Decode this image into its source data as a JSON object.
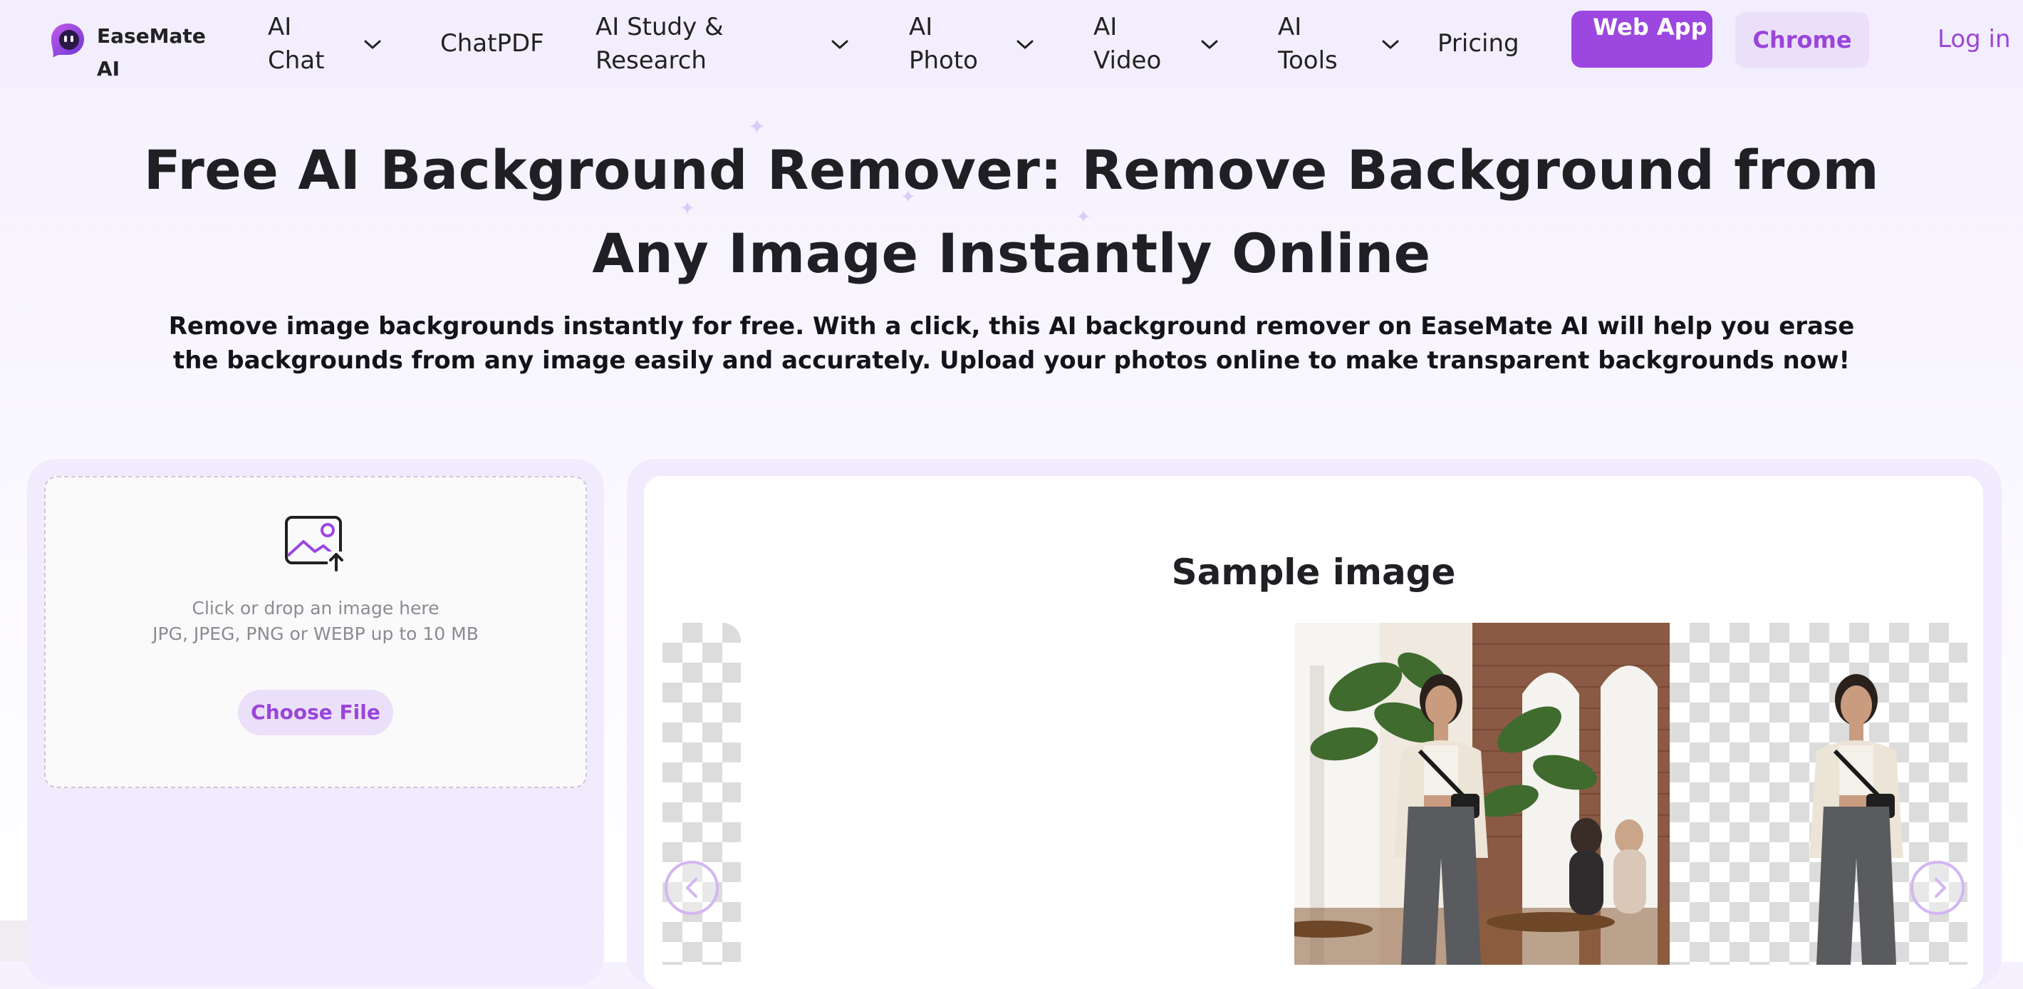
{
  "brand": {
    "name": "EaseMate AI"
  },
  "nav": {
    "ai_chat": "AI Chat",
    "chatpdf": "ChatPDF",
    "ai_study": "AI Study & Research",
    "ai_photo": "AI Photo",
    "ai_video": "AI Video",
    "ai_tools": "AI Tools",
    "pricing": "Pricing",
    "web_app": "Web App",
    "chrome": "Chrome",
    "login": "Log in"
  },
  "hero": {
    "title": "Free AI Background Remover: Remove Background from Any Image Instantly Online",
    "subtitle": "Remove image backgrounds instantly for free. With a click, this AI background remover on EaseMate AI will help you erase the backgrounds from any image easily and accurately. Upload your photos online to make transparent backgrounds now!"
  },
  "upload": {
    "hint": "Click or drop an image here",
    "formats": "JPG, JPEG, PNG or WEBP up to 10 MB",
    "choose_file": "Choose File"
  },
  "sample": {
    "title": "Sample image"
  },
  "colors": {
    "accent": "#9b47e0",
    "accent_text": "#9a45d8",
    "accent_soft": "#ebe0fa",
    "header_bg": "#f3eefd",
    "panel_bg": "#f1ebfd"
  },
  "icons": {
    "logo": "easemate-logo-icon",
    "chevron": "chevron-down-icon",
    "upload": "image-upload-icon",
    "prev": "chevron-left-icon",
    "next": "chevron-right-icon"
  }
}
